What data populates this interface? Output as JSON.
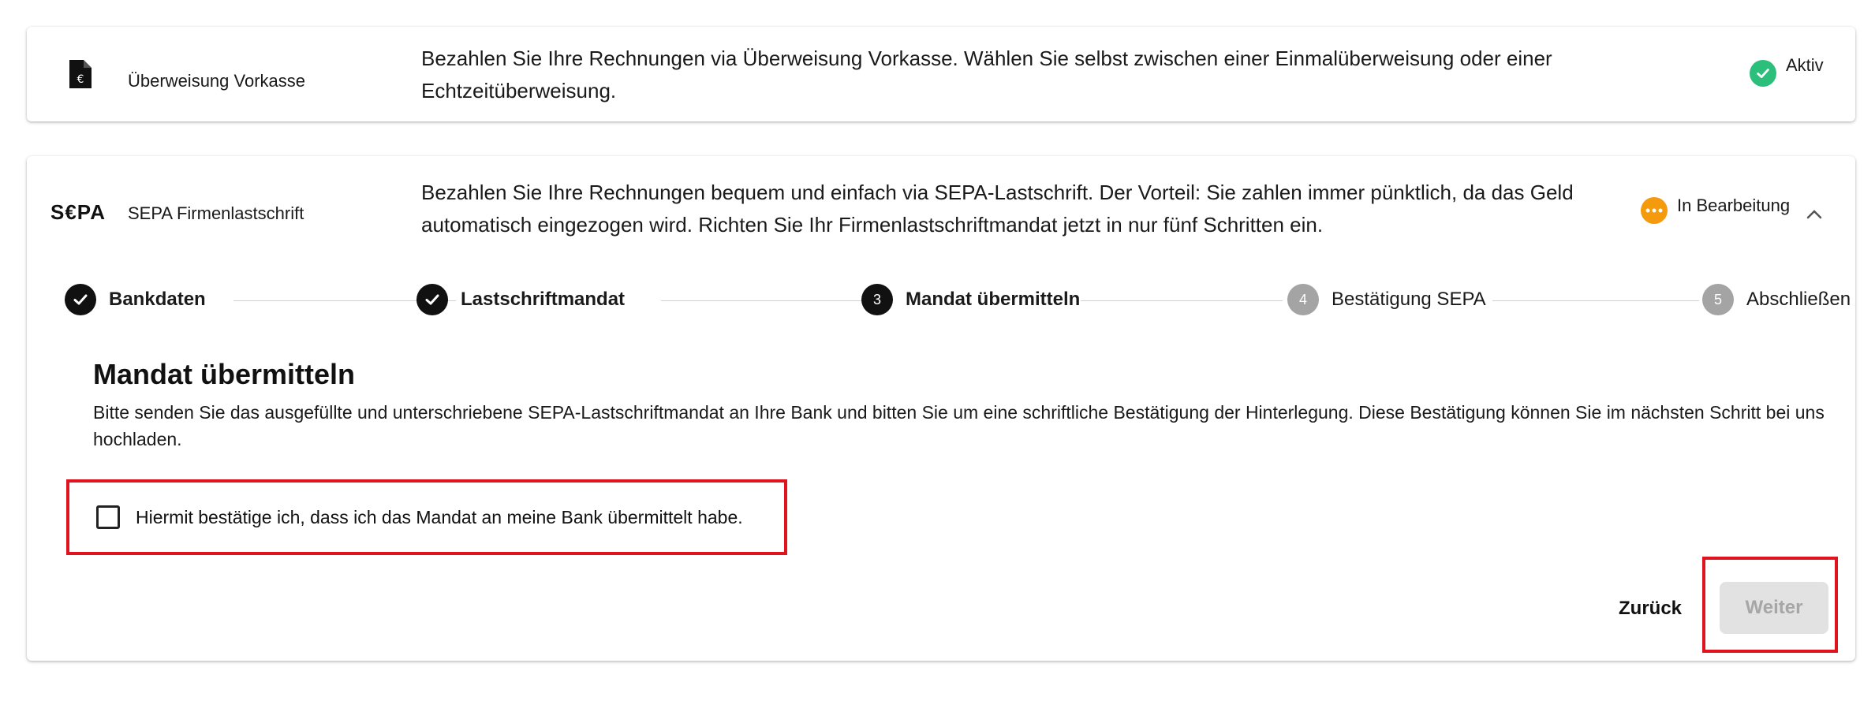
{
  "methods": [
    {
      "title": "Überweisung Vorkasse",
      "description": "Bezahlen Sie Ihre Rechnungen via Überweisung Vorkasse. Wählen Sie selbst zwischen einer Einmalüberweisung oder einer Echtzeitüberweisung.",
      "status": "Aktiv",
      "status_color": "#2bbf7b",
      "icon": "document-euro-icon"
    },
    {
      "logo": "S€PA",
      "title": "SEPA Firmenlastschrift",
      "description": "Bezahlen Sie Ihre Rechnungen bequem und einfach via SEPA-Lastschrift. Der Vorteil: Sie zahlen immer pünktlich, da das Geld automatisch eingezogen wird. Richten Sie Ihr Firmenlastschriftmandat jetzt in nur fünf Schritten ein.",
      "status": "In Bearbeitung",
      "status_color": "#f59a0c",
      "icon": "chevron-up-icon"
    }
  ],
  "stepper": {
    "steps": [
      {
        "number": "1",
        "label": "Bankdaten",
        "state": "done"
      },
      {
        "number": "2",
        "label": "Lastschriftmandat",
        "state": "done"
      },
      {
        "number": "3",
        "label": "Mandat übermitteln",
        "state": "active"
      },
      {
        "number": "4",
        "label": "Bestätigung SEPA",
        "state": "todo"
      },
      {
        "number": "5",
        "label": "Abschließen",
        "state": "todo"
      }
    ]
  },
  "step_content": {
    "title": "Mandat übermitteln",
    "text": "Bitte senden Sie das ausgefüllte und unterschriebene SEPA-Lastschriftmandat an Ihre Bank und bitten Sie um eine schriftliche Bestätigung der Hinterlegung. Diese Bestätigung können Sie im nächsten Schritt bei uns hochladen.",
    "checkbox_label": "Hiermit bestätige ich, dass ich das Mandat an meine Bank übermittelt habe.",
    "checkbox_checked": false
  },
  "actions": {
    "back_label": "Zurück",
    "next_label": "Weiter",
    "next_disabled": true
  },
  "colors": {
    "highlight": "#e0141e",
    "active_green": "#2bbf7b",
    "pending_orange": "#f59a0c"
  }
}
